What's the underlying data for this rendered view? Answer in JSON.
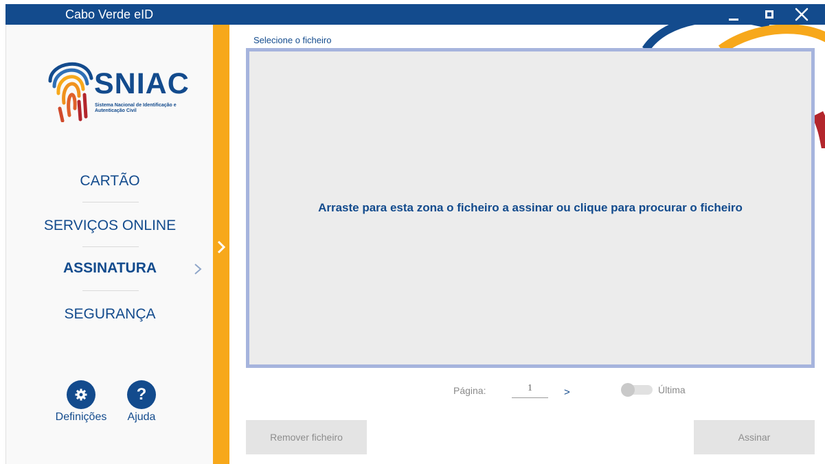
{
  "window": {
    "title": "Cabo Verde eID"
  },
  "logo": {
    "name": "SNIAC",
    "tagline": "Sistema Nacional de Identificação e Autenticação Civil"
  },
  "sidebar": {
    "items": [
      {
        "label": "CARTÃO",
        "active": false
      },
      {
        "label": "SERVIÇOS ONLINE",
        "active": false
      },
      {
        "label": "ASSINATURA",
        "active": true
      },
      {
        "label": "SEGURANÇA",
        "active": false
      }
    ],
    "settings_label": "Definições",
    "help_label": "Ajuda"
  },
  "main": {
    "section_label": "Selecione o ficheiro",
    "dropzone_text": "Arraste para esta zona o ficheiro a assinar ou clique para procurar o ficheiro",
    "pager": {
      "label": "Página:",
      "page": "1",
      "next": ">",
      "last_label": "Última",
      "last_enabled": false
    },
    "remove_button": "Remover ficheiro",
    "sign_button": "Assinar"
  },
  "colors": {
    "brand_blue": "#134b8d",
    "accent_orange": "#f7a81b",
    "dropzone_border": "#a6b4dd",
    "logo_red": "#b3262c"
  },
  "icons": {
    "settings": "gear-icon",
    "help": "question-icon",
    "expand": "chevron-right-icon",
    "active_item": "chevron-right-icon"
  }
}
